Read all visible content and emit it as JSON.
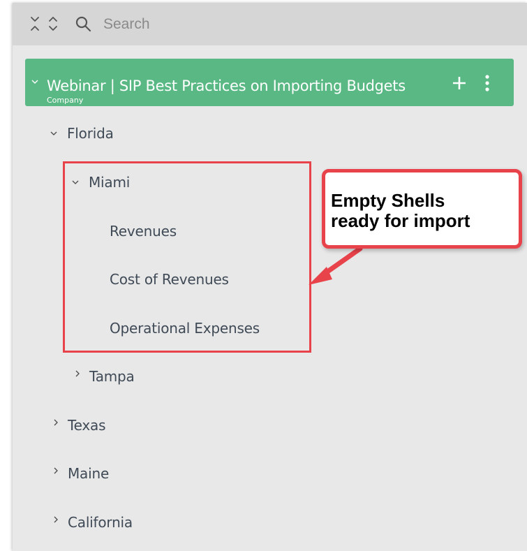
{
  "toolbar": {
    "expand_icon": "expand-all-icon",
    "collapse_icon": "collapse-all-icon",
    "search_icon": "search-icon",
    "search_placeholder": "Search"
  },
  "company": {
    "name": "Webinar | SIP Best Practices on Importing Budgets",
    "type_label": "Company",
    "color": "#59b883",
    "add_icon": "plus-icon",
    "menu_icon": "kebab-menu-icon"
  },
  "tree": {
    "florida": "Florida",
    "miami": "Miami",
    "revenues": "Revenues",
    "cost_of_revenues": "Cost of Revenues",
    "operational_expenses": "Operational Expenses",
    "tampa": "Tampa",
    "texas": "Texas",
    "maine": "Maine",
    "california": "California"
  },
  "annotation": {
    "callout_text": "Empty Shells\nready for import",
    "color": "#e8424a"
  }
}
